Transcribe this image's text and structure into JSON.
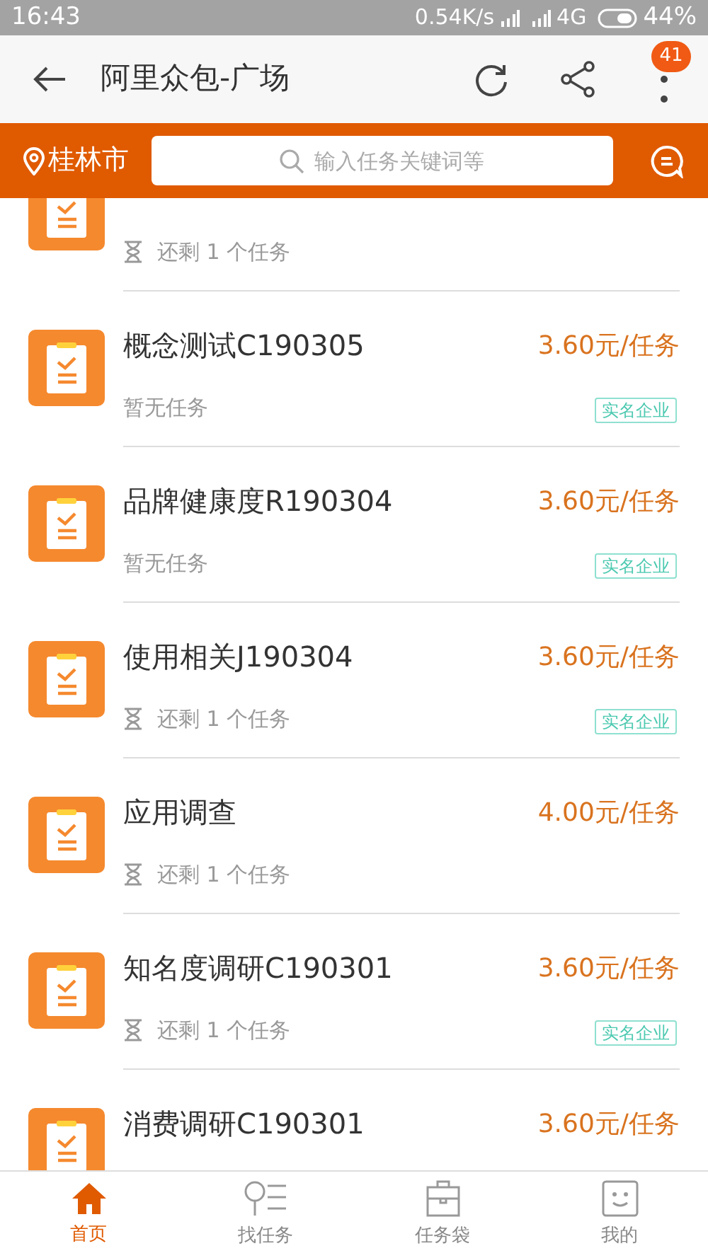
{
  "status_bar": {
    "time": "16:43",
    "speed": "0.54K/s",
    "network": "4G",
    "battery": "44%"
  },
  "header": {
    "title": "阿里众包-广场",
    "badge": "41"
  },
  "search_bar": {
    "city": "桂林市",
    "placeholder": "输入任务关键词等"
  },
  "tasks": [
    {
      "subtitle": "还剩 1 个任务",
      "kind": "remaining"
    },
    {
      "title": "概念测试C190305",
      "price": "3.60元/任务",
      "subtitle": "暂无任务",
      "kind": "none",
      "badge": "实名企业"
    },
    {
      "title": "品牌健康度R190304",
      "price": "3.60元/任务",
      "subtitle": "暂无任务",
      "kind": "none",
      "badge": "实名企业"
    },
    {
      "title": "使用相关J190304",
      "price": "3.60元/任务",
      "subtitle": "还剩 1 个任务",
      "kind": "remaining",
      "badge": "实名企业"
    },
    {
      "title": "应用调查",
      "price": "4.00元/任务",
      "subtitle": "还剩 1 个任务",
      "kind": "remaining"
    },
    {
      "title": "知名度调研C190301",
      "price": "3.60元/任务",
      "subtitle": "还剩 1 个任务",
      "kind": "remaining",
      "badge": "实名企业"
    },
    {
      "title": "消费调研C190301",
      "price": "3.60元/任务"
    }
  ],
  "bottom_nav": [
    {
      "label": "首页",
      "selected": true
    },
    {
      "label": "找任务",
      "selected": false
    },
    {
      "label": "任务袋",
      "selected": false
    },
    {
      "label": "我的",
      "selected": false
    }
  ]
}
